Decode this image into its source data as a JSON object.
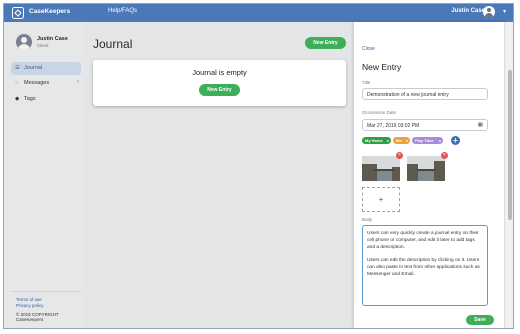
{
  "topbar": {
    "brand": "CaseKeepers",
    "nav_link": "Help/FAQs",
    "user_name": "Justin Case",
    "caret": "▾"
  },
  "sidebar": {
    "name": "Justin Case",
    "role": "Client",
    "items": [
      {
        "icon": "☰",
        "label": "Journal",
        "active": true
      },
      {
        "icon": "◌",
        "label": "Messages",
        "chevron": "‹"
      },
      {
        "icon": "◆",
        "label": "Tags"
      }
    ],
    "links": [
      "Terms of use",
      "Privacy policy"
    ],
    "copyright": "© 2019 COPYRIGHT CaseKeepers"
  },
  "main": {
    "title": "Journal",
    "new_entry_label": "New Entry",
    "empty_title": "Journal is empty",
    "empty_button": "New Entry"
  },
  "panel": {
    "close": "Close",
    "title": "New Entry",
    "title_label": "Title",
    "title_value": "Demonstration of a new journal entry",
    "date_label": "Occurrence Date",
    "date_value": "Mar 27, 2019 03:02 PM",
    "tags": [
      {
        "label": "My Home",
        "color": "#2f9e44"
      },
      {
        "label": "Me",
        "color": "#f0a23a"
      },
      {
        "label": "Play Time",
        "color": "#a98bd6"
      }
    ],
    "tag_remove": "x",
    "add_tag": "+",
    "photo_remove": "×",
    "add_photo": "+",
    "body_label": "Body",
    "body_paragraphs": [
      "Users can very quickly create a journal entry on their cell phone or computer, and edit it later to add tags and a description.",
      "Users can edit the description by clicking on it. Users can also paste in text from other applications such as Messenger and Email."
    ],
    "save": "Save"
  },
  "colors": {
    "accent": "#4a78b8",
    "primary_button": "#3fae5a",
    "link": "#2f5d9b"
  }
}
